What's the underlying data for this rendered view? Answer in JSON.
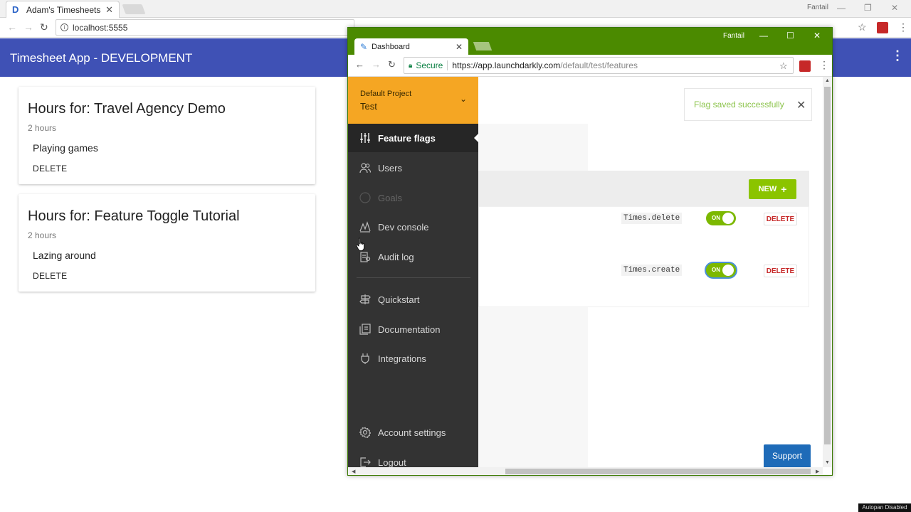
{
  "back_browser": {
    "tab_title": "Adam's Timesheets",
    "tab_favicon": "D",
    "user_name": "Fantail",
    "url": "localhost:5555"
  },
  "app": {
    "title": "Timesheet App - DEVELOPMENT",
    "entries": [
      {
        "heading": "Hours for: Travel Agency Demo",
        "hours": "2 hours",
        "description": "Playing games",
        "delete_label": "DELETE"
      },
      {
        "heading": "Hours for: Feature Toggle Tutorial",
        "hours": "2 hours",
        "description": "Lazing around",
        "delete_label": "DELETE"
      }
    ]
  },
  "front_browser": {
    "tab_title": "Dashboard",
    "user_name": "Fantail",
    "secure_label": "Secure",
    "url_host": "https://app.launchdarkly.com",
    "url_path": "/default/test/features"
  },
  "sidebar": {
    "project_name": "Default Project",
    "environment": "Test",
    "items": [
      {
        "label": "Feature flags",
        "icon": "sliders-icon"
      },
      {
        "label": "Users",
        "icon": "users-icon"
      },
      {
        "label": "Goals",
        "icon": "target-icon"
      },
      {
        "label": "Dev console",
        "icon": "chart-icon"
      },
      {
        "label": "Audit log",
        "icon": "log-icon"
      },
      {
        "label": "Quickstart",
        "icon": "signpost-icon"
      },
      {
        "label": "Documentation",
        "icon": "book-icon"
      },
      {
        "label": "Integrations",
        "icon": "plug-icon"
      },
      {
        "label": "Account settings",
        "icon": "gear-icon"
      },
      {
        "label": "Logout",
        "icon": "logout-icon"
      }
    ]
  },
  "content": {
    "toast_message": "Flag saved successfully",
    "new_button": "NEW",
    "flags": [
      {
        "key": "Times.delete",
        "toggle_label": "ON",
        "delete_label": "DELETE"
      },
      {
        "key": "Times.create",
        "toggle_label": "ON",
        "delete_label": "DELETE"
      }
    ],
    "support_button": "Support"
  },
  "overlay_label": "Autopan Disabled",
  "colors": {
    "app_bar": "#3f51b5",
    "ld_title_bar": "#4b8a00",
    "project_header": "#f5a623",
    "sidebar": "#333333",
    "toggle_on": "#7cb800",
    "new_button": "#8bc400",
    "support": "#1e6bb8"
  }
}
